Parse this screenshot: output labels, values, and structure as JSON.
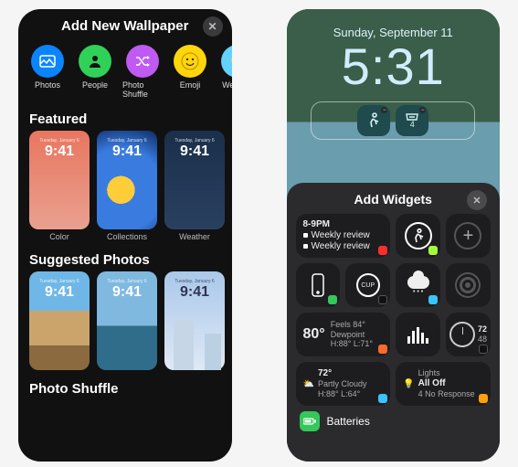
{
  "left": {
    "title": "Add New Wallpaper",
    "categories": [
      {
        "label": "Photos",
        "icon": "photos",
        "color": "#0a84ff"
      },
      {
        "label": "People",
        "icon": "person",
        "color": "#30d158"
      },
      {
        "label": "Photo Shuffle",
        "icon": "shuffle",
        "color": "#bf5af2"
      },
      {
        "label": "Emoji",
        "icon": "emoji",
        "color": "#ffd60a"
      },
      {
        "label": "Weather",
        "icon": "weather",
        "color": "#64d2ff"
      }
    ],
    "featured_title": "Featured",
    "featured": [
      {
        "label": "Color",
        "time": "9:41",
        "date": "Tuesday, January 6"
      },
      {
        "label": "Collections",
        "time": "9:41",
        "date": "Tuesday, January 6"
      },
      {
        "label": "Weather",
        "time": "9:41",
        "date": "Tuesday, January 6"
      }
    ],
    "suggested_title": "Suggested Photos",
    "suggested": [
      {
        "time": "9:41",
        "date": "Tuesday, January 6"
      },
      {
        "time": "9:41",
        "date": "Tuesday, January 6"
      },
      {
        "time": "9:41",
        "date": "Tuesday, January 6"
      }
    ],
    "shuffle_title": "Photo Shuffle"
  },
  "right": {
    "date": "Sunday, September 11",
    "time": "5:31",
    "ls_widgets": [
      {
        "icon": "walk",
        "badge": "−"
      },
      {
        "icon": "inbox",
        "value": "4",
        "badge": "−"
      }
    ],
    "sheet_title": "Add Widgets",
    "calendar": {
      "time": "8-9PM",
      "line1": "Weekly review",
      "line2": "Weekly review"
    },
    "weather": {
      "temp": "80°",
      "feels": "Feels 84°",
      "dew": "Dewpoint",
      "hi": "H:88°",
      "lo": "L:71°"
    },
    "clock": {
      "big": "72",
      "sm": "48"
    },
    "summary": {
      "temp": "72°",
      "cond": "Partly Cloudy",
      "hilo": "H:88° L:64°"
    },
    "lights": {
      "title": "Lights",
      "state": "All Off",
      "sub": "4 No Response"
    },
    "batteries": "Batteries"
  }
}
